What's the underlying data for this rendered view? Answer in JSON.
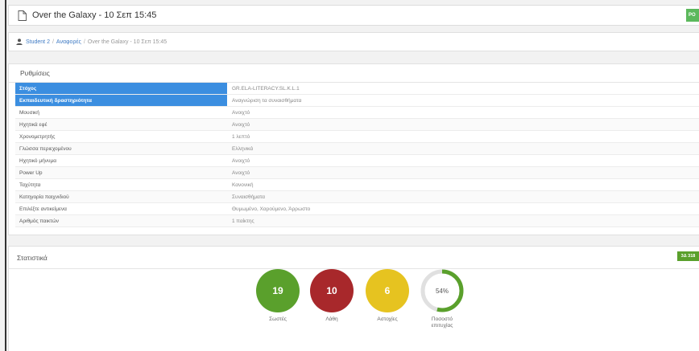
{
  "window": {
    "title": "Over the Galaxy - 10 Σεπ 15:45",
    "top_button_label": "PO"
  },
  "breadcrumb": {
    "items": [
      "Student 2",
      "Αναφορές",
      "Over the Galaxy - 10 Σεπ 15:45"
    ],
    "separator": "/"
  },
  "settings": {
    "heading": "Ρυθμίσεις",
    "rows": [
      {
        "label": "Στόχος",
        "value": "GR.ELA-LITERACY.SL.K.L.1"
      },
      {
        "label": "Εκπαιδευτική δραστηριότητα",
        "value": "Αναγνώριση τα συναισθήματα"
      },
      {
        "label": "Μουσική",
        "value": "Ανοιχτό"
      },
      {
        "label": "Ηχητικά εφέ",
        "value": "Ανοιχτό"
      },
      {
        "label": "Χρονομετρητής",
        "value": "1 λεπτό"
      },
      {
        "label": "Γλώσσα περιεχομένου",
        "value": "Ελληνικά"
      },
      {
        "label": "Ηχητικό μήνυμα",
        "value": "Ανοιχτό"
      },
      {
        "label": "Power Up",
        "value": "Ανοιχτό"
      },
      {
        "label": "Ταχύτητα",
        "value": "Κανονική"
      },
      {
        "label": "Κατηγορία παιχνιδιού",
        "value": "Συναισθήματα"
      },
      {
        "label": "Επιλέξτε αντικείμενα",
        "value": "Θυμωμένο, Χαρούμενο, Άρρωστο"
      },
      {
        "label": "Αριθμός παικτών",
        "value": "1 παίκτης"
      }
    ]
  },
  "stats": {
    "heading": "Στατιστικά",
    "badge": "3Δ 318",
    "items": [
      {
        "value": "19",
        "label": "Σωστές",
        "color": "#5aa02c"
      },
      {
        "value": "10",
        "label": "Λάθη",
        "color": "#a8282b"
      },
      {
        "value": "6",
        "label": "Αστοχίες",
        "color": "#e6c320"
      }
    ],
    "success": {
      "value": "54%",
      "fraction": 0.54,
      "label_line1": "Ποσοστό",
      "label_line2": "επιτυχίας",
      "color": "#5aa02c",
      "track_color": "#e0e0e0"
    }
  }
}
